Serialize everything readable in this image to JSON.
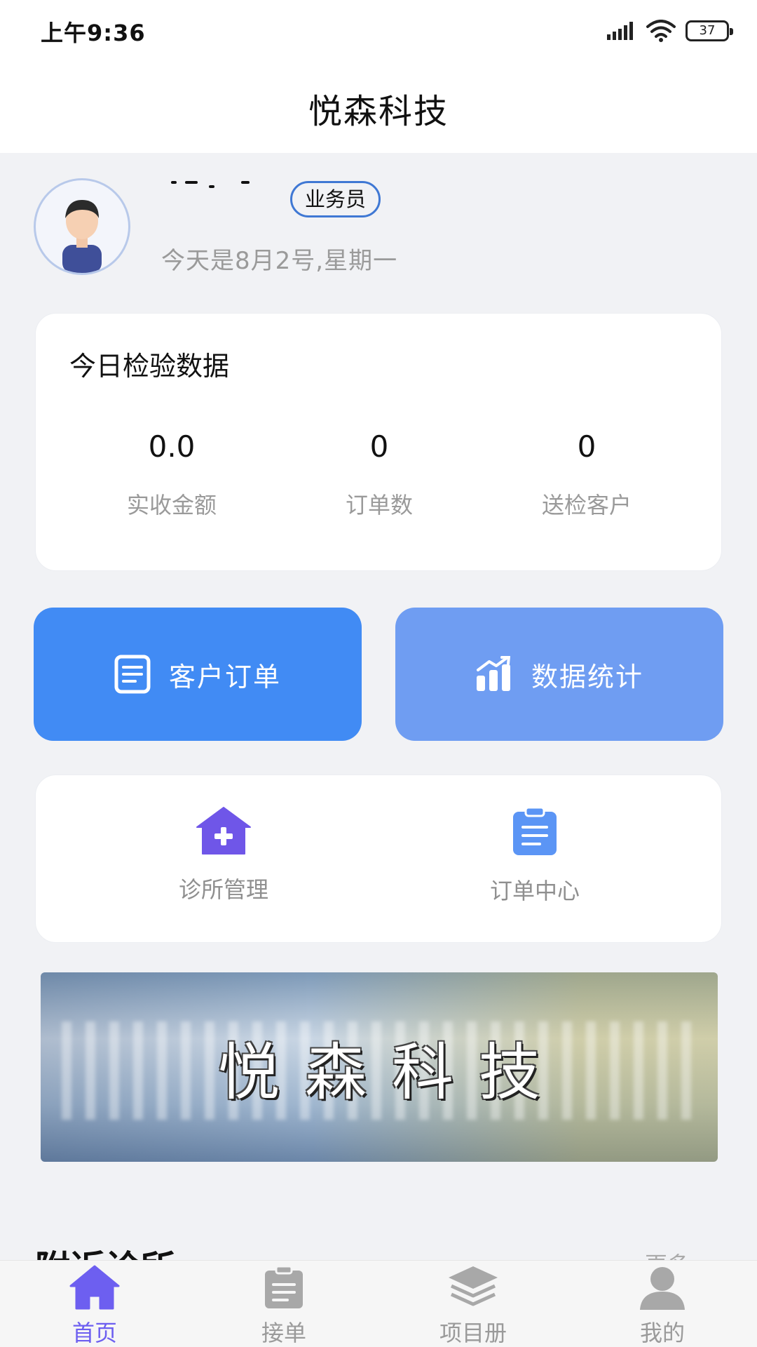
{
  "status_bar": {
    "time": "上午9:36",
    "battery": "37"
  },
  "header": {
    "title": "悦森科技"
  },
  "profile": {
    "role_badge": "业务员",
    "date_text": "今天是8月2号,星期一"
  },
  "stats_card": {
    "title": "今日检验数据",
    "items": [
      {
        "value": "0.0",
        "label": "实收金额"
      },
      {
        "value": "0",
        "label": "订单数"
      },
      {
        "value": "0",
        "label": "送检客户"
      }
    ]
  },
  "action_buttons": {
    "customer_orders": "客户订单",
    "data_statistics": "数据统计"
  },
  "menu": {
    "items": [
      {
        "label": "诊所管理",
        "icon": "clinic-plus-icon"
      },
      {
        "label": "订单中心",
        "icon": "clipboard-icon"
      }
    ]
  },
  "banner": {
    "text": "悦森科技"
  },
  "nearby": {
    "title": "附近诊所",
    "more": "更多"
  },
  "tabbar": {
    "items": [
      {
        "label": "首页",
        "icon": "home-icon",
        "active": true
      },
      {
        "label": "接单",
        "icon": "clipboard-icon",
        "active": false
      },
      {
        "label": "项目册",
        "icon": "layers-icon",
        "active": false
      },
      {
        "label": "我的",
        "icon": "user-icon",
        "active": false
      }
    ]
  },
  "colors": {
    "primary_button": "#418bf4",
    "secondary_button": "#6f9df2",
    "active_tab": "#6d5ff0",
    "inactive_tab": "#9a9a9a",
    "background": "#f1f2f5"
  }
}
